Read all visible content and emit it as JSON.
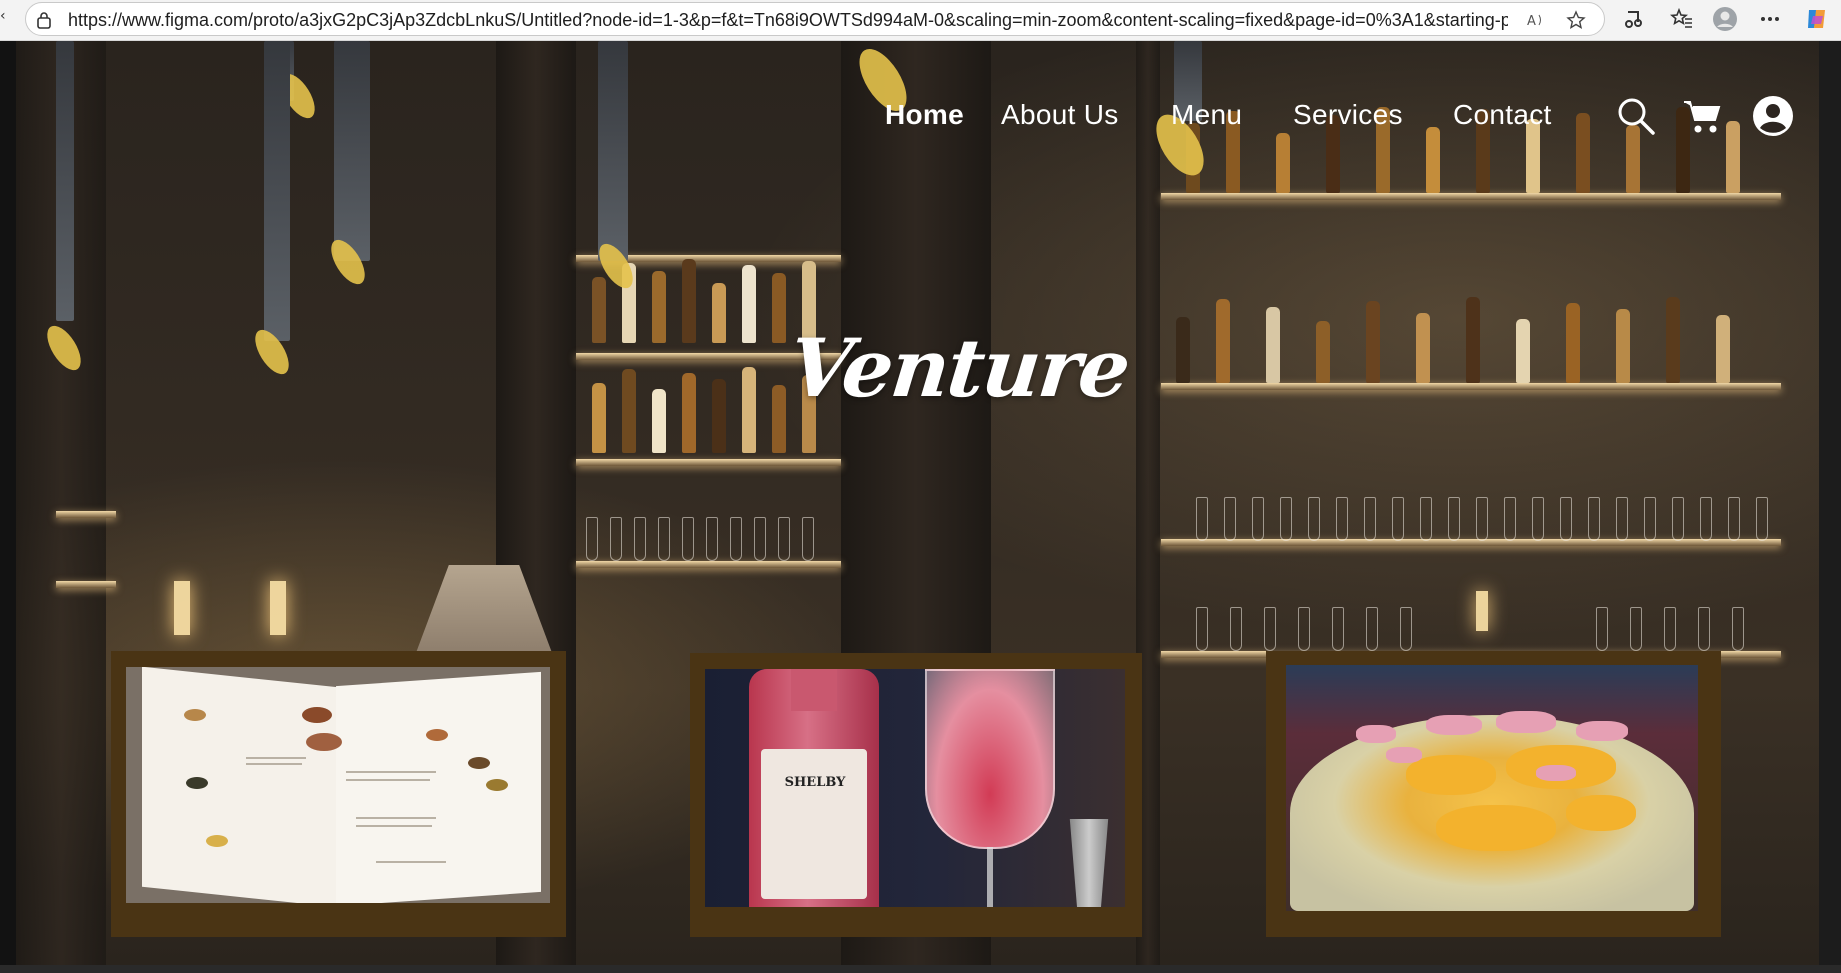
{
  "browser": {
    "url": "https://www.figma.com/proto/a3jxG2pC3jAp3ZdcbLnkuS/Untitled?node-id=1-3&p=f&t=Tn68i9OWTSd994aM-0&scaling=min-zoom&content-scaling=fixed&page-id=0%3A1&starting-p...",
    "icons": [
      "lock-icon",
      "read-aloud-icon",
      "favorite-star-icon",
      "media-icon",
      "favorites-list-icon",
      "profile-icon",
      "more-icon",
      "copilot-icon"
    ]
  },
  "site": {
    "brand": "Venture",
    "nav": [
      {
        "label": "Home",
        "active": true
      },
      {
        "label": "About Us",
        "active": false
      },
      {
        "label": "Menu",
        "active": false
      },
      {
        "label": "Services",
        "active": false
      },
      {
        "label": "Contact",
        "active": false
      }
    ],
    "nav_icons": [
      "search-icon",
      "cart-icon",
      "account-icon"
    ],
    "gin_label": "SHELBY",
    "cards": [
      {
        "subject": "menu-book-photo"
      },
      {
        "subject": "gin-cocktail-photo"
      },
      {
        "subject": "loaded-fries-photo"
      }
    ]
  },
  "colors": {
    "card_frame": "#4a3414",
    "nav_text": "#ffffff",
    "brand_text": "#ffffff"
  }
}
